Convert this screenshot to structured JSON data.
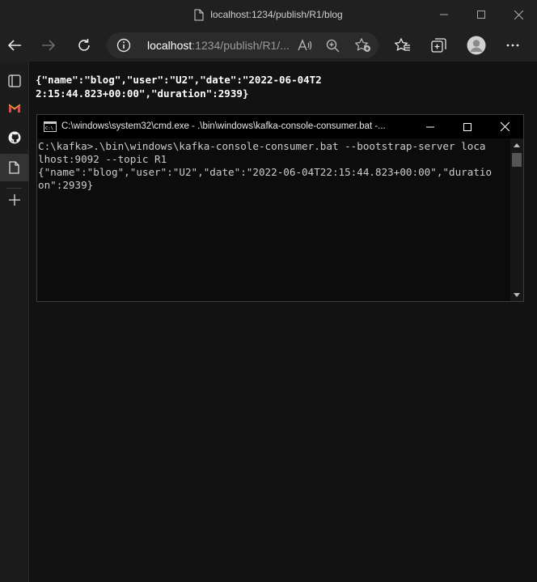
{
  "window": {
    "title": "localhost:1234/publish/R1/blog"
  },
  "toolbar": {
    "address_host": "localhost",
    "address_rest": ":1234/publish/R1/..."
  },
  "sidebar": {
    "items": [
      {
        "icon": "collections-icon"
      },
      {
        "icon": "gmail-icon"
      },
      {
        "icon": "github-icon"
      },
      {
        "icon": "document-icon"
      },
      {
        "icon": "add-icon"
      }
    ]
  },
  "page": {
    "json_text": "{\"name\":\"blog\",\"user\":\"U2\",\"date\":\"2022-06-04T22:15:44.823+00:00\",\"duration\":2939}"
  },
  "console": {
    "title": "C:\\windows\\system32\\cmd.exe - .\\bin\\windows\\kafka-console-consumer.bat  -...",
    "lines": [
      "C:\\kafka>.\\bin\\windows\\kafka-console-consumer.bat --bootstrap-server loca",
      "lhost:9092 --topic R1",
      "{\"name\":\"blog\",\"user\":\"U2\",\"date\":\"2022-06-04T22:15:44.823+00:00\",\"duratio",
      "on\":2939}"
    ]
  },
  "colors": {
    "browser_chrome": "#202020",
    "address_bar": "#2b2b2b",
    "page_background": "#121212",
    "console_background": "#0c0c0c",
    "console_text": "#cccccc"
  }
}
